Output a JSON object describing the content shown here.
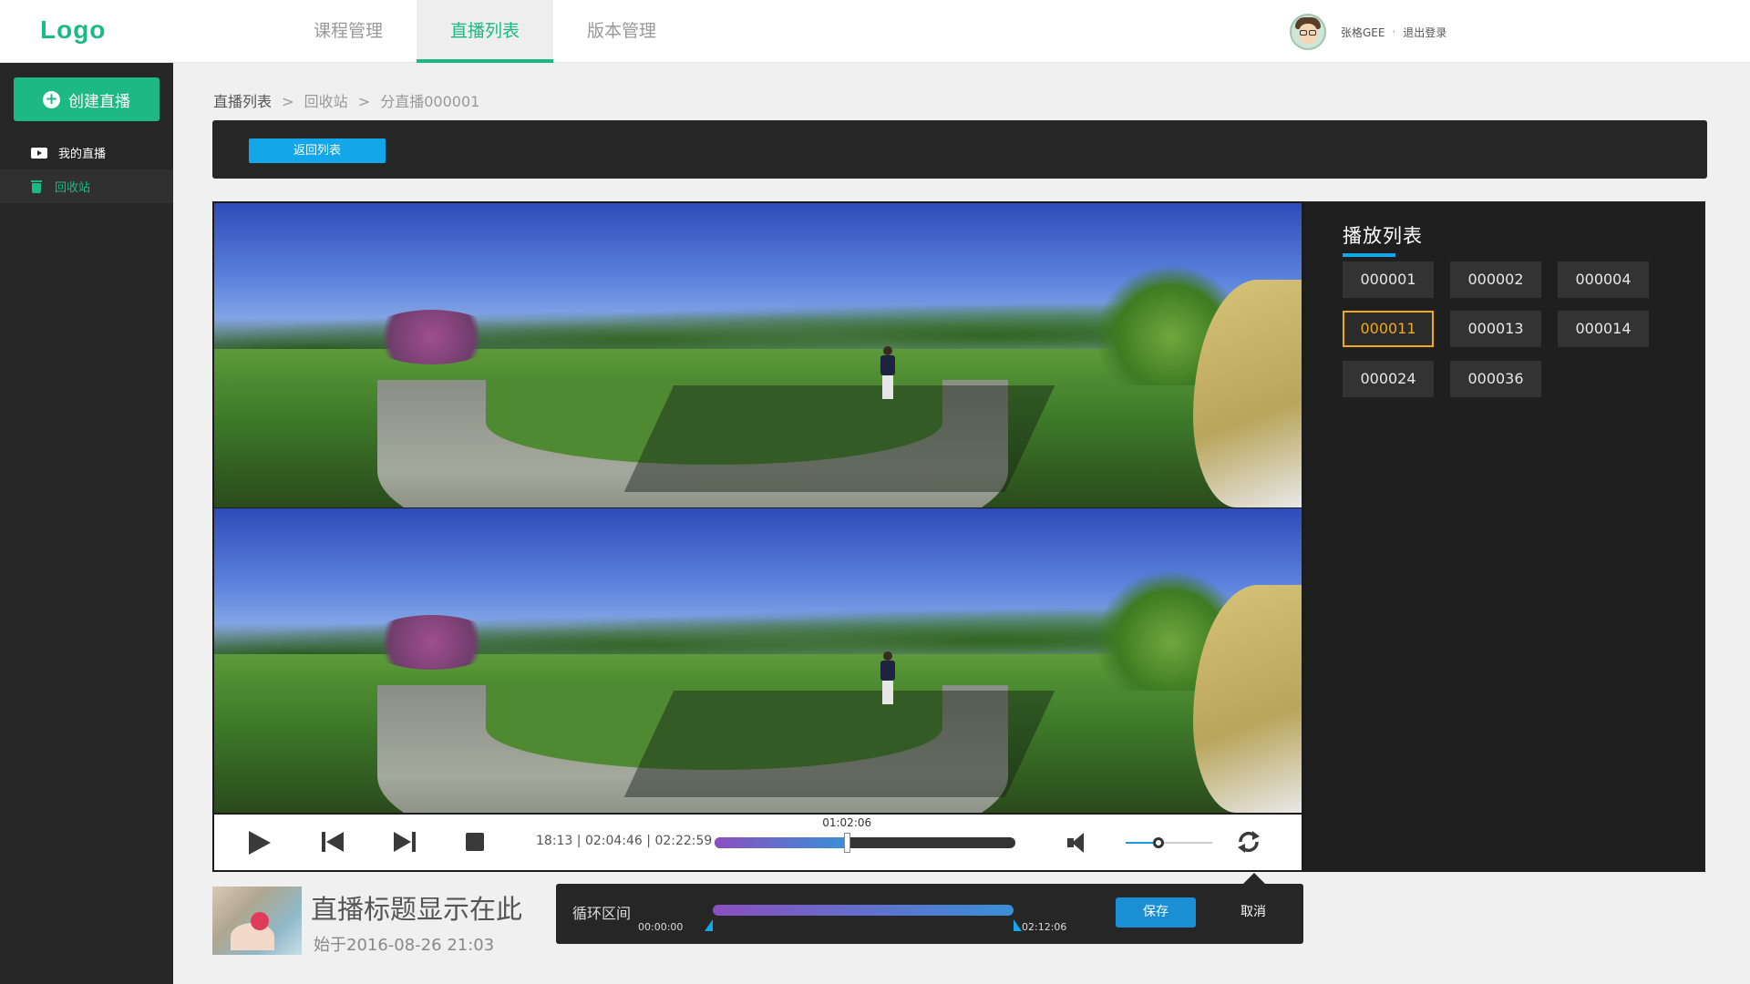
{
  "header": {
    "logo": "Logo",
    "nav": [
      {
        "label": "课程管理"
      },
      {
        "label": "直播列表"
      },
      {
        "label": "版本管理"
      }
    ],
    "user_name": "张格GEE",
    "separator": "·",
    "logout": "退出登录"
  },
  "sidebar": {
    "create_button": "创建直播",
    "items": [
      {
        "label": "我的直播",
        "icon": "video-icon"
      },
      {
        "label": "回收站",
        "icon": "trash-icon"
      }
    ]
  },
  "breadcrumb": {
    "items": [
      "直播列表",
      "回收站",
      "分直播000001"
    ],
    "separator": ">"
  },
  "toolbar": {
    "back_button": "返回列表"
  },
  "player": {
    "time_text": "18:13 | 02:04:46 | 02:22:59",
    "progress_tooltip": "01:02:06",
    "progress_fraction": 0.44,
    "volume_fraction": 0.38
  },
  "playlist": {
    "title": "播放列表",
    "items": [
      "000001",
      "000002",
      "000004",
      "000011",
      "000013",
      "000014",
      "000024",
      "000036"
    ],
    "active_index": 3
  },
  "live_info": {
    "title": "直播标题显示在此",
    "start": "始于2016-08-26  21:03"
  },
  "loop": {
    "label": "循环区间",
    "start_time": "00:00:00",
    "end_time": "02:12:06",
    "start_fraction": 0.0,
    "end_fraction": 1.0,
    "save": "保存",
    "cancel": "取消"
  },
  "colors": {
    "brand_green": "#1db985",
    "accent_blue": "#13a6e8",
    "active_orange": "#f0a91c"
  }
}
